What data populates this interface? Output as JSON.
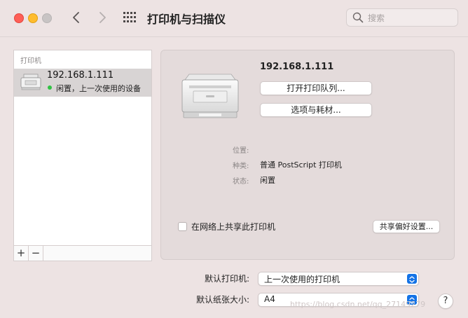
{
  "window": {
    "title": "打印机与扫描仪",
    "search_placeholder": "搜索"
  },
  "sidebar": {
    "header": "打印机",
    "printers": [
      {
        "name": "192.168.1.111",
        "status": "闲置，上一次使用的设备",
        "status_color": "#31c244",
        "selected": true
      }
    ],
    "add_label": "+",
    "remove_label": "−"
  },
  "detail": {
    "name": "192.168.1.111",
    "open_queue_label": "打开打印队列...",
    "options_label": "选项与耗材...",
    "location_label": "位置:",
    "location_value": "",
    "kind_label": "种类:",
    "kind_value": "普通 PostScript 打印机",
    "state_label": "状态:",
    "state_value": "闲置",
    "share_checkbox_label": "在网络上共享此打印机",
    "share_checked": false,
    "share_prefs_label": "共享偏好设置..."
  },
  "defaults": {
    "default_printer_label": "默认打印机:",
    "default_printer_value": "上一次使用的打印机",
    "default_paper_label": "默认纸张大小:",
    "default_paper_value": "A4"
  },
  "help_label": "?",
  "watermark": "https://blog.csdn.net/qq_27149279",
  "colors": {
    "window_bg": "#ede3e3",
    "accent": "#1473e6",
    "status_idle": "#31c244"
  }
}
